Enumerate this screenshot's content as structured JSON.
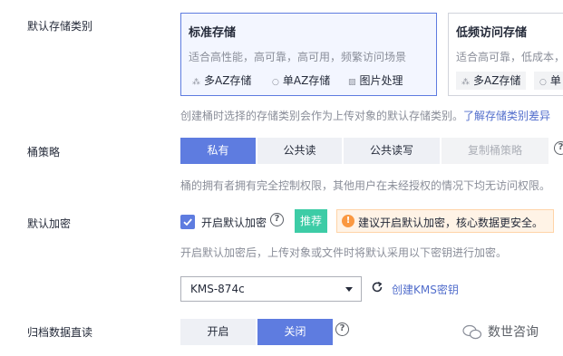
{
  "storage_class": {
    "label": "默认存储类别",
    "cards": [
      {
        "title": "标准存储",
        "desc": "适合高性能，高可靠，高可用，频繁访问场景",
        "features": [
          "多AZ存储",
          "单AZ存储",
          "图片处理"
        ],
        "selected": true
      },
      {
        "title": "低频访问存储",
        "desc": "适合高可靠，低成本，",
        "features": [
          "多AZ存储",
          "单"
        ],
        "selected": false
      }
    ],
    "hint": "创建桶时选择的存储类别会作为上传对象的默认存储类别。",
    "hint_link": "了解存储类别差异"
  },
  "bucket_policy": {
    "label": "桶策略",
    "options": [
      "私有",
      "公共读",
      "公共读写",
      "复制桶策略"
    ],
    "selected": "私有",
    "disabled": "复制桶策略",
    "hint": "桶的拥有者拥有完全控制权限，其他用户在未经授权的情况下均无访问权限。"
  },
  "encryption": {
    "label": "默认加密",
    "checkbox_label": "开启默认加密",
    "checked": true,
    "recommend_badge": "推荐",
    "alert": "建议开启默认加密，核心数据更安全。",
    "hint": "开启默认加密后，上传对象或文件时将默认采用以下密钥进行加密。",
    "key_value": "KMS-874c",
    "create_key_link": "创建KMS密钥"
  },
  "archive_read": {
    "label": "归档数据直读",
    "options": [
      "开启",
      "关闭"
    ],
    "selected": "关闭"
  },
  "watermark": "数世咨询",
  "colors": {
    "accent": "#5e7ce0",
    "recommend": "#3dcca6",
    "warning": "#fa9841",
    "link": "#526ecc"
  }
}
